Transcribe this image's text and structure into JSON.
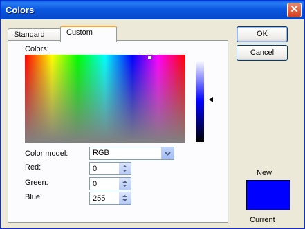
{
  "window": {
    "title": "Colors",
    "close_glyph": "✕"
  },
  "tabs": [
    {
      "label": "Standard"
    },
    {
      "label": "Custom"
    }
  ],
  "labels": {
    "colors": "Colors:",
    "color_model": "Color model:",
    "red": "Red:",
    "green": "Green:",
    "blue": "Blue:"
  },
  "color_model": {
    "selected": "RGB"
  },
  "values": {
    "red": "0",
    "green": "0",
    "blue": "255"
  },
  "buttons": {
    "ok": "OK",
    "cancel": "Cancel"
  },
  "preview": {
    "new_label": "New",
    "current_label": "Current",
    "new_color": "#0000ff"
  }
}
